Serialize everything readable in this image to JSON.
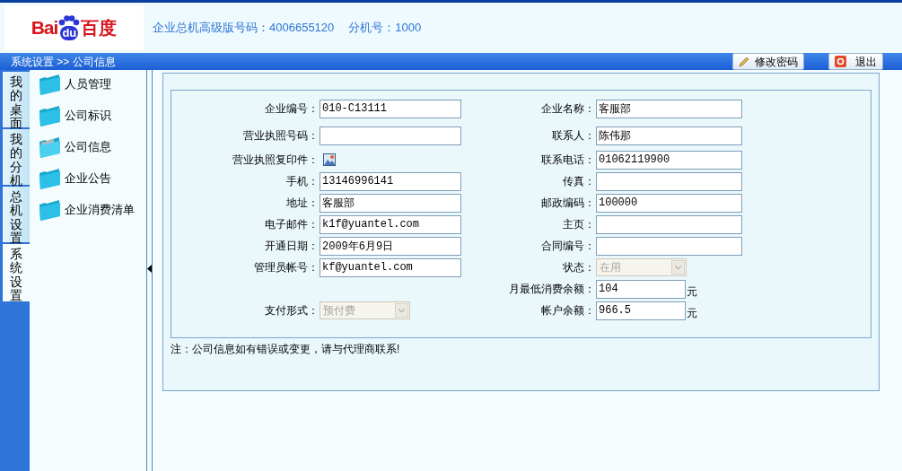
{
  "header": {
    "logo": {
      "left": "Bai",
      "mid": "du",
      "right": "百度"
    },
    "hotline": "企业总机高级版号码：4006655120",
    "extension": "分机号：1000"
  },
  "breadcrumb": "系统设置 >> 公司信息",
  "actions": [
    {
      "kind": "edit",
      "label": "修改密码"
    },
    {
      "kind": "exit",
      "label": "退出"
    }
  ],
  "side_tabs": [
    {
      "label": "我的桌面",
      "selected": false
    },
    {
      "label": "我的分机",
      "selected": false
    },
    {
      "label": "总机设置",
      "selected": false
    },
    {
      "label": "系统设置",
      "selected": true
    }
  ],
  "menu": [
    {
      "label": "人员管理",
      "selected": false
    },
    {
      "label": "公司标识",
      "selected": false
    },
    {
      "label": "公司信息",
      "selected": true
    },
    {
      "label": "企业公告",
      "selected": false
    },
    {
      "label": "企业消费清单",
      "selected": false
    }
  ],
  "form": {
    "rows": [
      {
        "left": {
          "kind": "text",
          "label": "企业编号：",
          "value": "010-C13111"
        },
        "right": {
          "kind": "text",
          "label": "企业名称：",
          "value": "客服部"
        }
      },
      {
        "left": {
          "kind": "text",
          "label": "营业执照号码："
        },
        "right": {
          "kind": "text",
          "label": "联系人：",
          "value": "陈伟那"
        }
      },
      {
        "left": {
          "kind": "image",
          "label": "营业执照复印件："
        },
        "right": {
          "kind": "text",
          "label": "联系电话：",
          "value": "01062119900"
        }
      },
      {
        "left": {
          "kind": "text",
          "label": "手机：",
          "value": "13146996141"
        },
        "right": {
          "kind": "text",
          "label": "传真："
        }
      },
      {
        "left": {
          "kind": "text",
          "label": "地址：",
          "value": "客服部"
        },
        "right": {
          "kind": "text",
          "label": "邮政编码：",
          "value": "100000"
        }
      },
      {
        "left": {
          "kind": "text",
          "label": "电子邮件：",
          "value": "k1f@yuantel.com"
        },
        "right": {
          "kind": "text",
          "label": "主页："
        }
      },
      {
        "left": {
          "kind": "text",
          "label": "开通日期：",
          "value": "2009年6月9日"
        },
        "right": {
          "kind": "text",
          "label": "合同编号："
        }
      },
      {
        "left": {
          "kind": "text",
          "label": "管理员帐号：",
          "value": "kf@yuantel.com"
        },
        "right": {
          "kind": "select",
          "label": "状态：",
          "value": "在用",
          "disabled": true
        }
      },
      {
        "right": {
          "kind": "money",
          "label": "月最低消费余额：",
          "value": "104",
          "unit": "元"
        }
      },
      {
        "left": {
          "kind": "select",
          "label": "支付形式：",
          "value": "预付费",
          "disabled": true
        },
        "right": {
          "kind": "money",
          "label": "帐户余额：",
          "value": "966.5",
          "unit": "元"
        }
      }
    ]
  },
  "note": "注：公司信息如有错误或变更，请与代理商联系!"
}
